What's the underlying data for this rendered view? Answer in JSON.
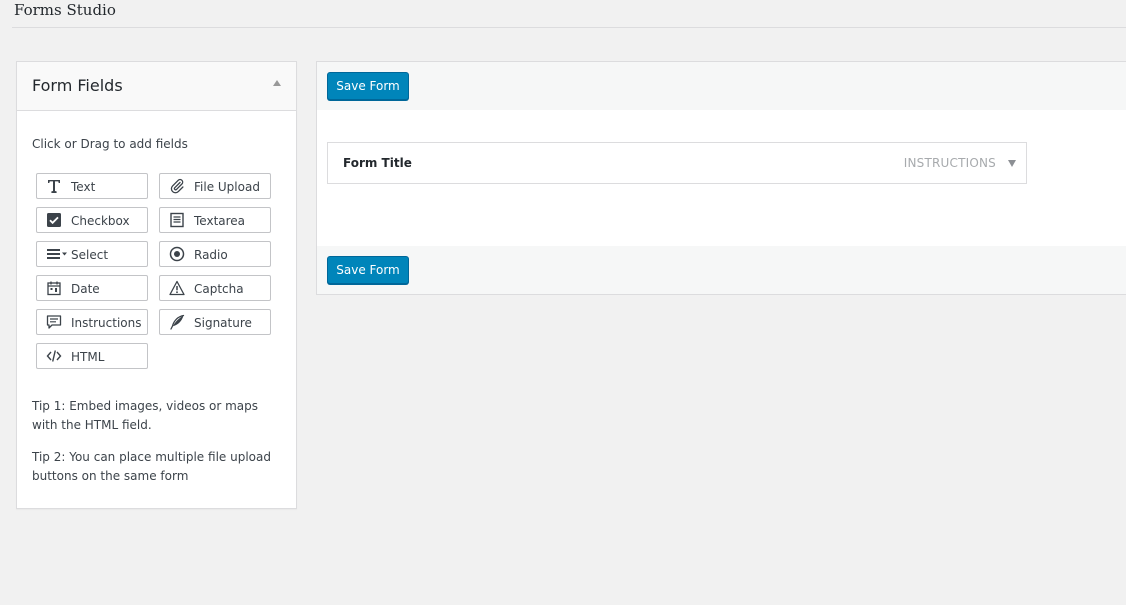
{
  "header": {
    "title": "Forms Studio"
  },
  "panel": {
    "title": "Form Fields",
    "hint": "Click or Drag to add fields",
    "fields": [
      {
        "label": "Text",
        "icon": "text-icon"
      },
      {
        "label": "File Upload",
        "icon": "paperclip-icon"
      },
      {
        "label": "Checkbox",
        "icon": "checkbox-icon"
      },
      {
        "label": "Textarea",
        "icon": "textarea-icon"
      },
      {
        "label": "Select",
        "icon": "select-icon"
      },
      {
        "label": "Radio",
        "icon": "radio-icon"
      },
      {
        "label": "Date",
        "icon": "calendar-icon"
      },
      {
        "label": "Captcha",
        "icon": "warning-icon"
      },
      {
        "label": "Instructions",
        "icon": "comment-icon"
      },
      {
        "label": "Signature",
        "icon": "feather-icon"
      },
      {
        "label": "HTML",
        "icon": "code-icon"
      }
    ],
    "tip1": "Tip 1: Embed images, videos or maps with the HTML field.",
    "tip2": "Tip 2: You can place multiple file upload buttons on the same form"
  },
  "builder": {
    "save_label_top": "Save Form",
    "save_label_bottom": "Save Form",
    "form_title": "Form Title",
    "instructions_label": "INSTRUCTIONS"
  },
  "colors": {
    "primary": "#0085ba",
    "background": "#f1f1f1"
  }
}
